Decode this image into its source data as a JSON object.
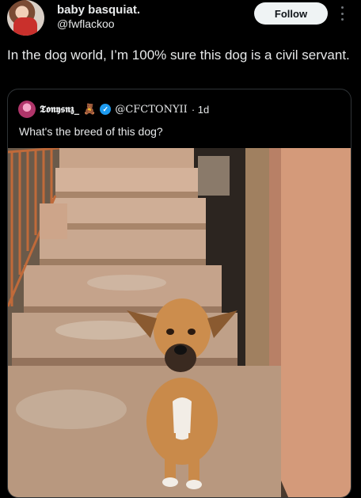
{
  "post": {
    "author_name": "baby basquiat.",
    "author_handle": "@fwflackoo",
    "follow_label": "Follow",
    "text": "In the dog world, I’m 100% sure this dog is a civil servant."
  },
  "quoted_post": {
    "author_name": "𝕿𝖔𝖓𝖞𝖘𝖓𝖟_",
    "author_handle": "@CFCTONYII",
    "time": "· 1d",
    "text": "What's the breed of this dog?",
    "bear_emoji": "🧸",
    "verified_mark": "✓",
    "image_alt": "A tan dog sitting at the bottom of concrete stairs"
  },
  "icons": [
    "avatar",
    "more-icon",
    "verified-icon",
    "bear-icon"
  ],
  "colors": {
    "follow_bg": "#eff3f4",
    "verified": "#1d9bf0",
    "background": "#000000"
  }
}
